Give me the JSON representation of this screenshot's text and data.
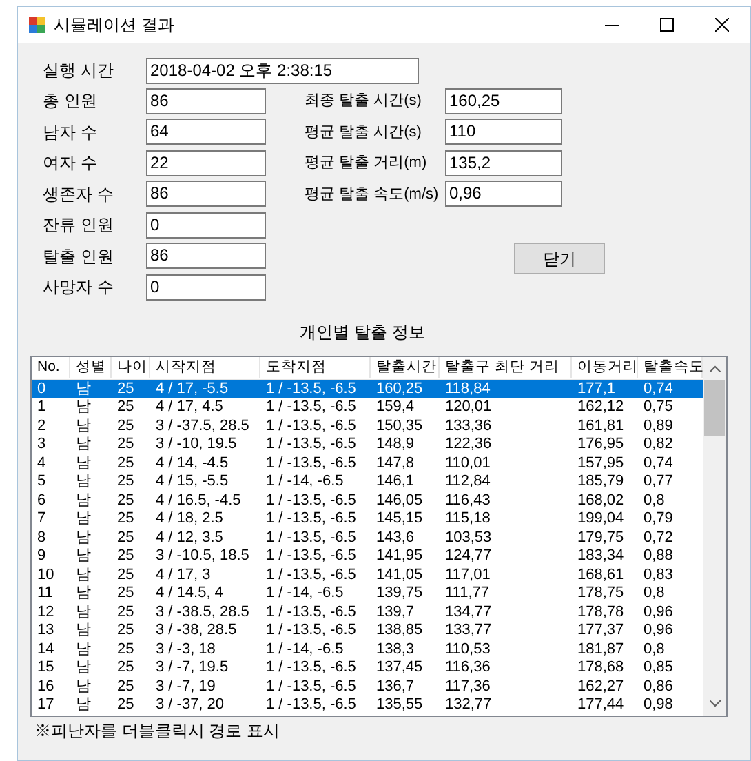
{
  "window": {
    "title": "시뮬레이션 결과"
  },
  "run_time": {
    "label": "실행 시간",
    "value": "2018-04-02 오후 2:38:15"
  },
  "left_fields": [
    {
      "label": "총 인원",
      "value": "86"
    },
    {
      "label": "남자 수",
      "value": "64"
    },
    {
      "label": "여자 수",
      "value": "22"
    },
    {
      "label": "생존자 수",
      "value": "86"
    },
    {
      "label": "잔류 인원",
      "value": "0"
    },
    {
      "label": "탈출 인원",
      "value": "86"
    },
    {
      "label": "사망자 수",
      "value": "0"
    }
  ],
  "right_fields": [
    {
      "label": "최종 탈출 시간(s)",
      "value": "160,25"
    },
    {
      "label": "평균 탈출 시간(s)",
      "value": "110"
    },
    {
      "label": "평균 탈출 거리(m)",
      "value": "135,2"
    },
    {
      "label": "평균 탈출 속도(m/s)",
      "value": "0,96"
    }
  ],
  "close_button": "닫기",
  "list_title": "개인별 탈출 정보",
  "table": {
    "columns": [
      "No.",
      "성별",
      "나이",
      "시작지점",
      "도착지점",
      "탈출시간",
      "탈출구 최단 거리",
      "이동거리",
      "탈출속도"
    ],
    "rows": [
      {
        "selected": true,
        "cells": [
          "0",
          "남",
          "25",
          "4 / 17, -5.5",
          "1 / -13.5, -6.5",
          "160,25",
          "118,84",
          "177,1",
          "0,74"
        ]
      },
      {
        "selected": false,
        "cells": [
          "1",
          "남",
          "25",
          "4 / 17, 4.5",
          "1 / -13.5, -6.5",
          "159,4",
          "120,01",
          "162,12",
          "0,75"
        ]
      },
      {
        "selected": false,
        "cells": [
          "2",
          "남",
          "25",
          "3 / -37.5, 28.5",
          "1 / -13.5, -6.5",
          "150,35",
          "133,36",
          "161,81",
          "0,89"
        ]
      },
      {
        "selected": false,
        "cells": [
          "3",
          "남",
          "25",
          "3 / -10, 19.5",
          "1 / -13.5, -6.5",
          "148,9",
          "122,36",
          "176,95",
          "0,82"
        ]
      },
      {
        "selected": false,
        "cells": [
          "4",
          "남",
          "25",
          "4 / 14, -4.5",
          "1 / -13.5, -6.5",
          "147,8",
          "110,01",
          "157,95",
          "0,74"
        ]
      },
      {
        "selected": false,
        "cells": [
          "5",
          "남",
          "25",
          "4 / 15, -5.5",
          "1 / -14, -6.5",
          "146,1",
          "112,84",
          "185,79",
          "0,77"
        ]
      },
      {
        "selected": false,
        "cells": [
          "6",
          "남",
          "25",
          "4 / 16.5, -4.5",
          "1 / -13.5, -6.5",
          "146,05",
          "116,43",
          "168,02",
          "0,8"
        ]
      },
      {
        "selected": false,
        "cells": [
          "7",
          "남",
          "25",
          "4 / 18, 2.5",
          "1 / -13.5, -6.5",
          "145,15",
          "115,18",
          "199,04",
          "0,79"
        ]
      },
      {
        "selected": false,
        "cells": [
          "8",
          "남",
          "25",
          "4 / 12, 3.5",
          "1 / -13.5, -6.5",
          "143,6",
          "103,53",
          "179,75",
          "0,72"
        ]
      },
      {
        "selected": false,
        "cells": [
          "9",
          "남",
          "25",
          "3 / -10.5, 18.5",
          "1 / -13.5, -6.5",
          "141,95",
          "124,77",
          "183,34",
          "0,88"
        ]
      },
      {
        "selected": false,
        "cells": [
          "10",
          "남",
          "25",
          "4 / 17, 3",
          "1 / -13.5, -6.5",
          "141,05",
          "117,01",
          "168,61",
          "0,83"
        ]
      },
      {
        "selected": false,
        "cells": [
          "11",
          "남",
          "25",
          "4 / 14.5, 4",
          "1 / -14, -6.5",
          "139,75",
          "111,77",
          "178,75",
          "0,8"
        ]
      },
      {
        "selected": false,
        "cells": [
          "12",
          "남",
          "25",
          "3 / -38.5, 28.5",
          "1 / -13.5, -6.5",
          "139,7",
          "134,77",
          "178,78",
          "0,96"
        ]
      },
      {
        "selected": false,
        "cells": [
          "13",
          "남",
          "25",
          "3 / -38, 28.5",
          "1 / -13.5, -6.5",
          "138,85",
          "133,77",
          "177,37",
          "0,96"
        ]
      },
      {
        "selected": false,
        "cells": [
          "14",
          "남",
          "25",
          "3 / -3, 18",
          "1 / -14, -6.5",
          "138,3",
          "110,53",
          "181,87",
          "0,8"
        ]
      },
      {
        "selected": false,
        "cells": [
          "15",
          "남",
          "25",
          "3 / -7, 19.5",
          "1 / -13.5, -6.5",
          "137,45",
          "116,36",
          "178,68",
          "0,85"
        ]
      },
      {
        "selected": false,
        "cells": [
          "16",
          "남",
          "25",
          "3 / -7, 19",
          "1 / -13.5, -6.5",
          "136,7",
          "117,36",
          "162,27",
          "0,86"
        ]
      },
      {
        "selected": false,
        "cells": [
          "17",
          "남",
          "25",
          "3 / -37, 20",
          "1 / -13.5, -6.5",
          "135,55",
          "132,77",
          "177,44",
          "0,98"
        ]
      }
    ]
  },
  "footnote": "※피난자를 더블클릭시 경로 표시"
}
